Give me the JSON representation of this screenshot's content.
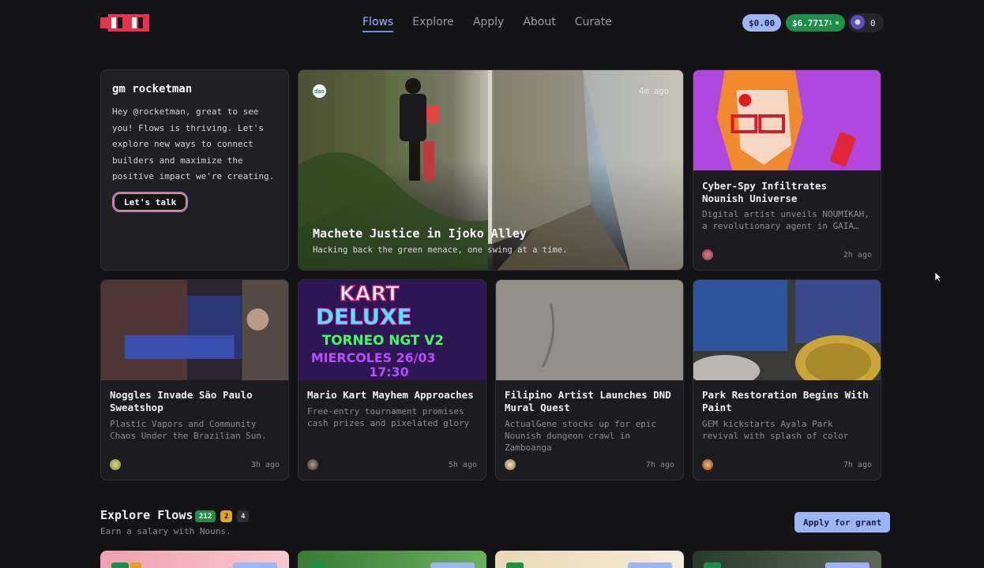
{
  "nav": {
    "items": [
      "Flows",
      "Explore",
      "Apply",
      "About",
      "Curate"
    ],
    "active": "Flows"
  },
  "wallet": {
    "balance_blue": "$0.00",
    "balance_green": "$6.7717",
    "balance_green_sub": "1",
    "notifications": "0"
  },
  "welcome": {
    "title": "gm rocketman",
    "body": "Hey @rocketman, great to see you! Flows is thriving. Let's explore new ways to connect builders and maximize the positive impact we're creating.",
    "button": "Let's talk"
  },
  "hero": {
    "badge_text": "dao",
    "time": "4m ago",
    "title": "Machete Justice in Ijoko Alley",
    "subtitle": "Hacking back the green menace, one swing at a time."
  },
  "cards": [
    {
      "title": "Cyber-Spy Infiltrates Nounish Universe",
      "subtitle": "Digital artist unveils NOUMIKAH, a revolutionary agent in GAIA…",
      "time": "2h ago",
      "img": "cyberspy"
    },
    {
      "title": "Noggles Invade São Paulo Sweatshop",
      "subtitle": "Plastic Vapors and Community Chaos Under the Brazilian Sun.",
      "time": "3h ago",
      "img": "noggles"
    },
    {
      "title": "Mario Kart Mayhem Approaches",
      "subtitle": "Free-entry tournament promises cash prizes and pixelated glory",
      "time": "5h ago",
      "img": "kart"
    },
    {
      "title": "Filipino Artist Launches DND Mural Quest",
      "subtitle": "ActualGene stocks up for epic Nounish dungeon crawl in Zamboanga",
      "time": "7h ago",
      "img": "wall"
    },
    {
      "title": "Park Restoration Begins With Paint",
      "subtitle": "GEM kickstarts Ayala Park revival with splash of color",
      "time": "7h ago",
      "img": "paint"
    }
  ],
  "kart_poster": {
    "line1": "KART",
    "line2": "DELUXE",
    "line3": "TORNEO NGT V2",
    "line4": "MIERCOLES 26/03",
    "line5": "17:30"
  },
  "explore": {
    "title": "Explore Flows",
    "badges": [
      "212",
      "2",
      "4"
    ],
    "subtitle": "Earn a salary with Nouns.",
    "button": "Apply for grant"
  },
  "colors": {
    "accent": "#9db5f5",
    "green": "#1f8f47",
    "amber": "#e0a51c",
    "background": "#141416"
  }
}
